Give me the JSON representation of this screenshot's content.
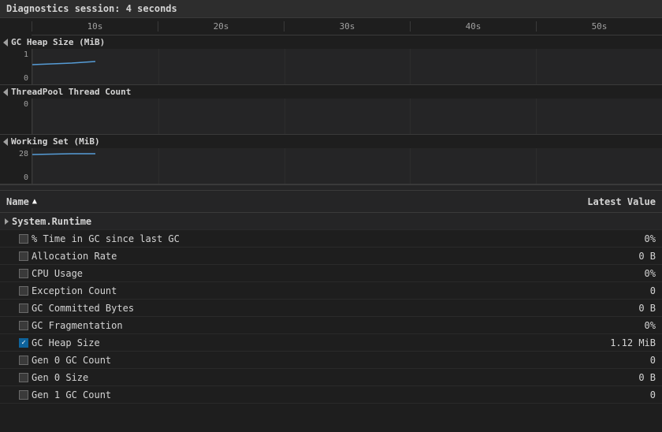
{
  "header": {
    "title": "Diagnostics session: 4 seconds"
  },
  "timeAxis": {
    "ticks": [
      "10s",
      "20s",
      "30s",
      "40s",
      "50s"
    ]
  },
  "charts": [
    {
      "id": "gc-heap",
      "label": "GC Heap Size (MiB)",
      "yMax": "1",
      "yMin": "0",
      "hasLine": true
    },
    {
      "id": "threadpool",
      "label": "ThreadPool Thread Count",
      "yMax": "0",
      "yMin": "",
      "hasLine": false
    },
    {
      "id": "working-set",
      "label": "Working Set (MiB)",
      "yMax": "28",
      "yMin": "0",
      "hasLine": true
    }
  ],
  "table": {
    "columns": {
      "name": "Name",
      "value": "Latest Value"
    },
    "groups": [
      {
        "name": "System.Runtime",
        "rows": [
          {
            "id": "time-in-gc",
            "name": "% Time in GC since last GC",
            "value": "0%",
            "checked": false
          },
          {
            "id": "alloc-rate",
            "name": "Allocation Rate",
            "value": "0 B",
            "checked": false
          },
          {
            "id": "cpu-usage",
            "name": "CPU Usage",
            "value": "0%",
            "checked": false
          },
          {
            "id": "exception-count",
            "name": "Exception Count",
            "value": "0",
            "checked": false
          },
          {
            "id": "gc-committed",
            "name": "GC Committed Bytes",
            "value": "0 B",
            "checked": false
          },
          {
            "id": "gc-frag",
            "name": "GC Fragmentation",
            "value": "0%",
            "checked": false
          },
          {
            "id": "gc-heap-size",
            "name": "GC Heap Size",
            "value": "1.12 MiB",
            "checked": true
          },
          {
            "id": "gen0-count",
            "name": "Gen 0 GC Count",
            "value": "0",
            "checked": false
          },
          {
            "id": "gen0-size",
            "name": "Gen 0 Size",
            "value": "0 B",
            "checked": false
          },
          {
            "id": "gen1-count",
            "name": "Gen 1 GC Count",
            "value": "0",
            "checked": false
          }
        ]
      }
    ]
  }
}
